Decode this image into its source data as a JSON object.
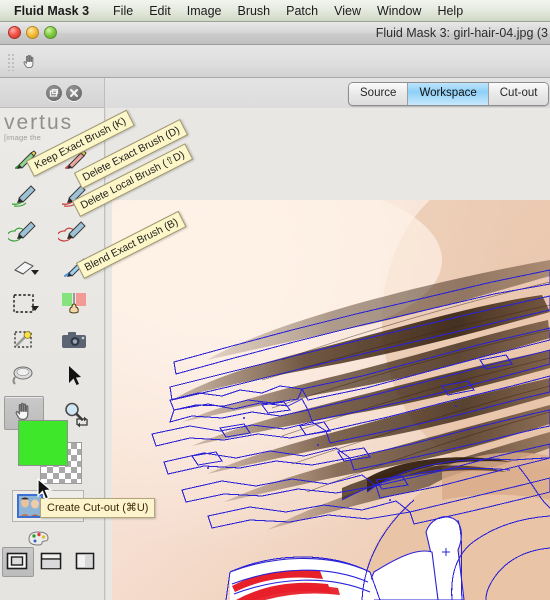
{
  "menubar": {
    "items": [
      {
        "label": "Fluid Mask 3",
        "app": true
      },
      {
        "label": "File"
      },
      {
        "label": "Edit"
      },
      {
        "label": "Image"
      },
      {
        "label": "Brush"
      },
      {
        "label": "Patch"
      },
      {
        "label": "View"
      },
      {
        "label": "Window"
      },
      {
        "label": "Help"
      }
    ]
  },
  "window": {
    "title": "Fluid Mask 3: girl-hair-04.jpg (3",
    "traffic_lights": [
      "close-red",
      "minimize-yellow",
      "zoom-green"
    ]
  },
  "toolstrip": {
    "grip": "drag-grip",
    "active_tool_icon": "hand-icon"
  },
  "panel_header": {
    "collapse_icon": "collapse-icon",
    "close_icon": "close-icon"
  },
  "tabs": [
    {
      "label": "Source",
      "selected": false
    },
    {
      "label": "Workspace",
      "selected": true
    },
    {
      "label": "Cut-out",
      "selected": false
    }
  ],
  "brand": {
    "wordmark": "vertus",
    "tagline": "[image the"
  },
  "tools": [
    {
      "name": "keep-exact-brush-tool",
      "icon": "green-pen-icon",
      "column": "left",
      "row": 0,
      "selected": false
    },
    {
      "name": "delete-exact-brush-tool",
      "icon": "red-pen-icon",
      "column": "right",
      "row": 0,
      "selected": false
    },
    {
      "name": "keep-local-brush-tool",
      "icon": "green-brush-icon",
      "column": "left",
      "row": 1,
      "selected": false
    },
    {
      "name": "delete-local-brush-tool",
      "icon": "red-brush-icon",
      "column": "right",
      "row": 1,
      "selected": false
    },
    {
      "name": "keep-global-brush-tool",
      "icon": "green-spiral-brush-icon",
      "column": "left",
      "row": 2,
      "selected": false
    },
    {
      "name": "delete-global-brush-tool",
      "icon": "red-spiral-brush-icon",
      "column": "right",
      "row": 2,
      "selected": false
    },
    {
      "name": "eraser-tool",
      "icon": "eraser-icon",
      "column": "left",
      "row": 3,
      "selected": false,
      "has_menu": true
    },
    {
      "name": "blend-exact-brush-tool",
      "icon": "blue-pen-icon",
      "column": "right",
      "row": 3,
      "selected": false,
      "has_menu": true
    },
    {
      "name": "rectangle-select-tool",
      "icon": "marquee-icon",
      "column": "left",
      "row": 4,
      "selected": false,
      "has_menu": true
    },
    {
      "name": "blend-fill-tool",
      "icon": "fill-hand-icon",
      "column": "right",
      "row": 4,
      "selected": false
    },
    {
      "name": "magic-wand-tool",
      "icon": "magic-wand-icon",
      "column": "left",
      "row": 5,
      "selected": false
    },
    {
      "name": "snapshot-tool",
      "icon": "camera-icon",
      "column": "right",
      "row": 5,
      "selected": false
    },
    {
      "name": "patch-tool",
      "icon": "patch-spoon-icon",
      "column": "left",
      "row": 6,
      "selected": false
    },
    {
      "name": "pointer-tool",
      "icon": "arrow-pointer-icon",
      "column": "right",
      "row": 6,
      "selected": false
    },
    {
      "name": "hand-pan-tool",
      "icon": "hand-icon",
      "column": "left",
      "row": 7,
      "selected": true
    },
    {
      "name": "zoom-tool",
      "icon": "magnifier-icon",
      "column": "right",
      "row": 7,
      "selected": false
    }
  ],
  "swatches": {
    "foreground_color": "#3ee72a",
    "background": "transparent-checker",
    "swap_icon": "swap-arrows-icon"
  },
  "cutout_preview": {
    "thumb_selected_name": "cutout-thumb-masked",
    "thumb_other_name": "cutout-thumb-original",
    "palette_icon": "palette-icon"
  },
  "view_modes": [
    {
      "name": "view-mode-overlay",
      "icon": "layout-overlay-icon",
      "selected": true
    },
    {
      "name": "view-mode-split",
      "icon": "layout-split-icon",
      "selected": false
    },
    {
      "name": "view-mode-single",
      "icon": "layout-single-icon",
      "selected": false
    }
  ],
  "tooltips": [
    {
      "text": "Keep Exact Brush (K)",
      "rotated": true
    },
    {
      "text": "Delete Exact Brush (D)",
      "rotated": true
    },
    {
      "text": "Delete Local Brush (⇧D)",
      "rotated": true
    },
    {
      "text": "Blend Exact Brush (B)",
      "rotated": true
    },
    {
      "text": "Create Cut-out (⌘U)",
      "rotated": false
    }
  ],
  "canvas": {
    "image_name": "girl-hair-04.jpg",
    "mask_outline_color": "#2a22d8",
    "subject": "girl with flowing hair, red and white striped top",
    "cursor_icon": "arrow-cursor-icon"
  },
  "colors": {
    "menubar_tint": "#dde3d4",
    "tab_selected": "#8fd0f7",
    "tooltip_bg": "#fdf6c8",
    "panel_bg": "#eceae6",
    "mask_blue": "#2a22d8",
    "skin": "#efd3bd",
    "hair_dark": "#3a2313",
    "stripe_red": "#e8202a"
  }
}
